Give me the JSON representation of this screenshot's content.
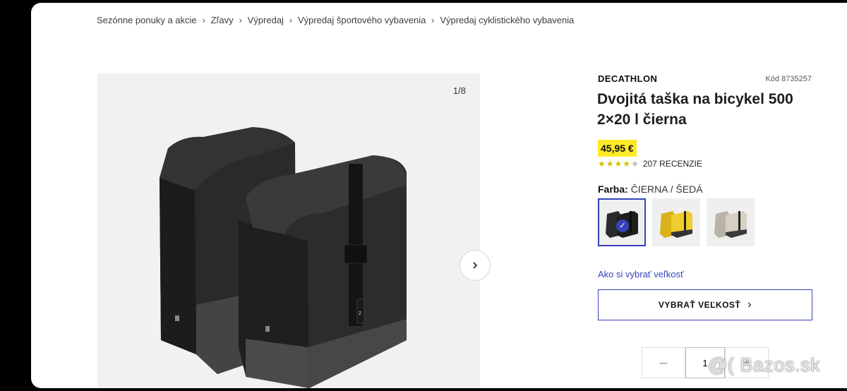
{
  "breadcrumb": [
    {
      "label": "Sezónne ponuky a akcie"
    },
    {
      "label": "Zľavy"
    },
    {
      "label": "Výpredaj"
    },
    {
      "label": "Výpredaj športového vybavenia"
    },
    {
      "label": "Výpredaj cyklistického vybavenia"
    }
  ],
  "gallery": {
    "counter": "1/8"
  },
  "product": {
    "brand": "DECATHLON",
    "code": "Kód 8735257",
    "title": "Dvojitá taška na bicykel 500 2×20 l čierna",
    "price": "45,95 €",
    "rating": 4.5,
    "reviews": "207 RECENZIE",
    "color_label": "Farba:",
    "color_value": "ČIERNA / ŠEDÁ",
    "size_link": "Ako si vybrať veľkosť",
    "size_button": "VYBRAŤ VEĽKOSŤ",
    "quantity": "1"
  },
  "colors": {
    "accent": "#3643ba",
    "price_bg": "#ffea28",
    "star": "#d8c100"
  },
  "watermark": "@( Bazos.sk"
}
